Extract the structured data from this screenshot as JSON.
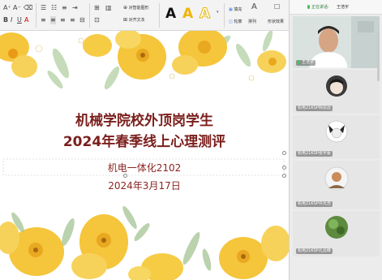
{
  "ribbon": {
    "font_row_icons": [
      "A⁺",
      "A⁻",
      "⌫"
    ],
    "para_row_icons": [
      "☰",
      "☷",
      "≡",
      "⇥"
    ],
    "arrange_label": "对智能图形",
    "format_label": "对齐文本",
    "textbox_label": "文本框",
    "shape_label": "形状",
    "fill_label": "填充",
    "outline_label": "轮廓",
    "arrange_label2": "排列",
    "edit_label": "编辑",
    "font_style_label": "A",
    "shape_effects_label": "形状效果"
  },
  "slide": {
    "title_line1": "机械学院校外顶岗学生",
    "title_line2": "2024年春季线上心理测评",
    "class_name": "机电一体化2102",
    "date": "2024年3月17日"
  },
  "panel": {
    "status": "正在讲话:",
    "speaker": "王浩宇",
    "participants": [
      {
        "label": "王浩宇"
      },
      {
        "label": "机电21KSP杨思远"
      },
      {
        "label": "机电21KSP张宇豪"
      },
      {
        "label": "机电21KSP许光浩"
      },
      {
        "label": "机电21KSP孔云峰"
      }
    ]
  },
  "colors": {
    "title": "#7a1f1c",
    "petal": "#f5c53b",
    "petal_dark": "#e8a820",
    "leaf": "#a9c89a",
    "panel_bg": "#ececec"
  }
}
